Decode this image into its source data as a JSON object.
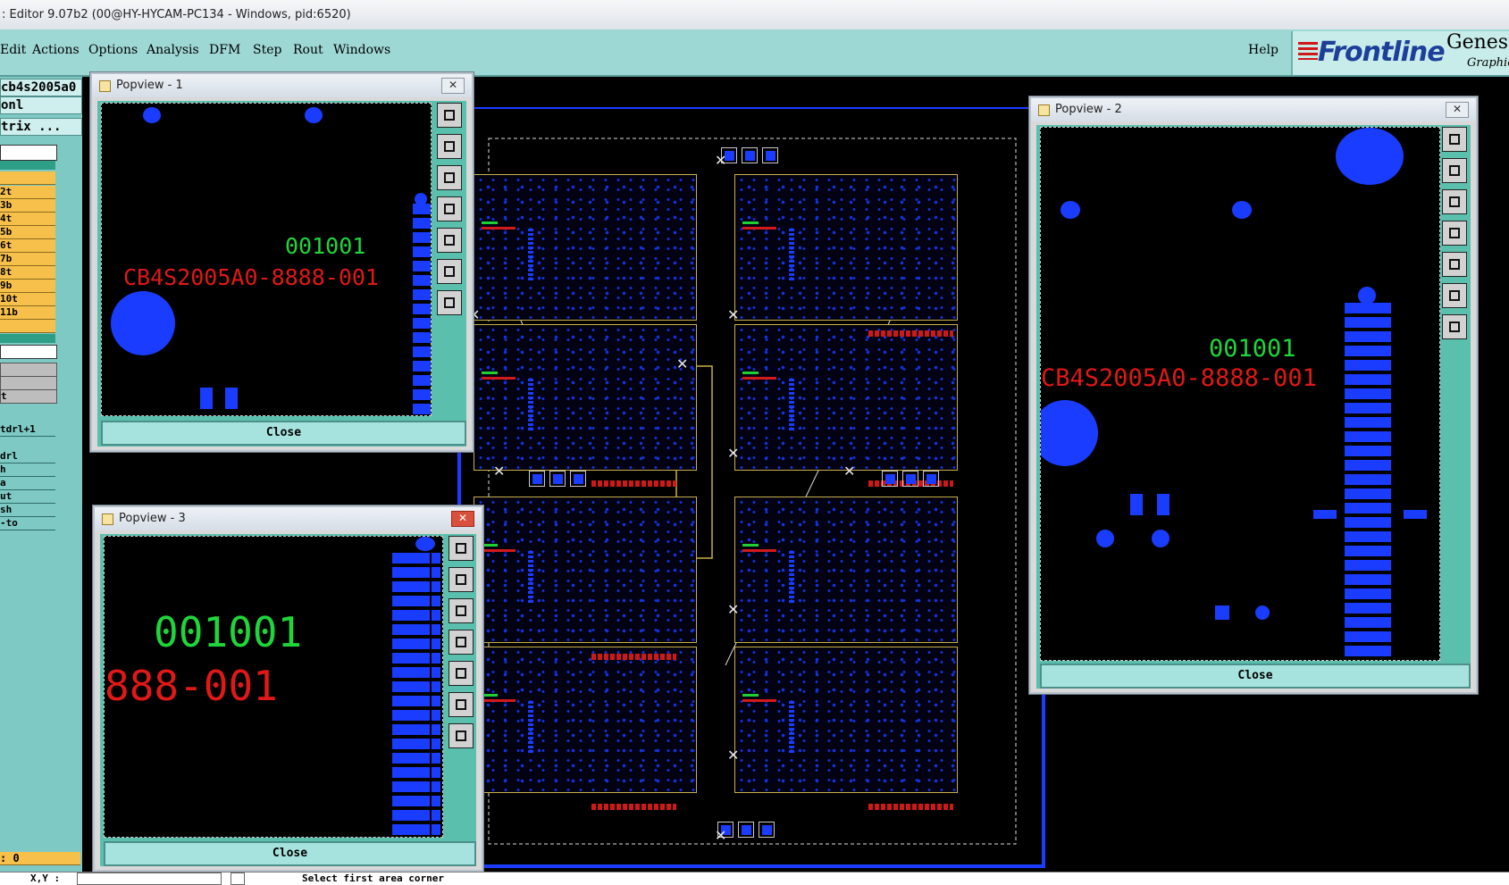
{
  "window": {
    "title": ": Editor 9.07b2 (00@HY-HYCAM-PC134 - Windows, pid:6520)"
  },
  "menu": {
    "items": [
      "Edit",
      "Actions",
      "Options",
      "Analysis",
      "DFM",
      "Step",
      "Rout",
      "Windows"
    ],
    "help": "Help"
  },
  "brand": {
    "logo": "Frontline",
    "product": "Genesis",
    "subtitle": "Graphic"
  },
  "left_panel": {
    "job": "cb4s2005a0",
    "step": "onl",
    "matrix": "trix ...",
    "layers": [
      "2t",
      "3b",
      "4t",
      "5b",
      "6t",
      "7b",
      "8t",
      "9b",
      "10t",
      "11b"
    ],
    "rows": [
      "t",
      "tdrl+1",
      "drl",
      "h",
      "a",
      "ut",
      "sh",
      "-to"
    ],
    "counter": ": 0"
  },
  "popviews": [
    {
      "title": "Popview - 1",
      "close_label": "Close",
      "text_green": "001001",
      "text_red": "CB4S2005A0-8888-001"
    },
    {
      "title": "Popview - 2",
      "close_label": "Close",
      "text_green": "001001",
      "text_red": "CB4S2005A0-8888-001"
    },
    {
      "title": "Popview - 3",
      "close_label": "Close",
      "text_green": "001001",
      "text_red": "888-001"
    }
  ],
  "status": {
    "coord_label": "X,Y :",
    "message": "Select first area corner"
  },
  "icons": [
    "close-icon",
    "zoom-home-icon",
    "pan-up-icon",
    "pan-down-icon",
    "pan-left-icon",
    "pan-right-icon",
    "zoom-fit-icon",
    "zoom-in-icon"
  ],
  "colors": {
    "menu_bg": "#9ed8d5",
    "layer_highlight": "#f7c04a",
    "pad_blue": "#1a3cff",
    "text_green": "#1fd63a",
    "text_red": "#e01818"
  }
}
